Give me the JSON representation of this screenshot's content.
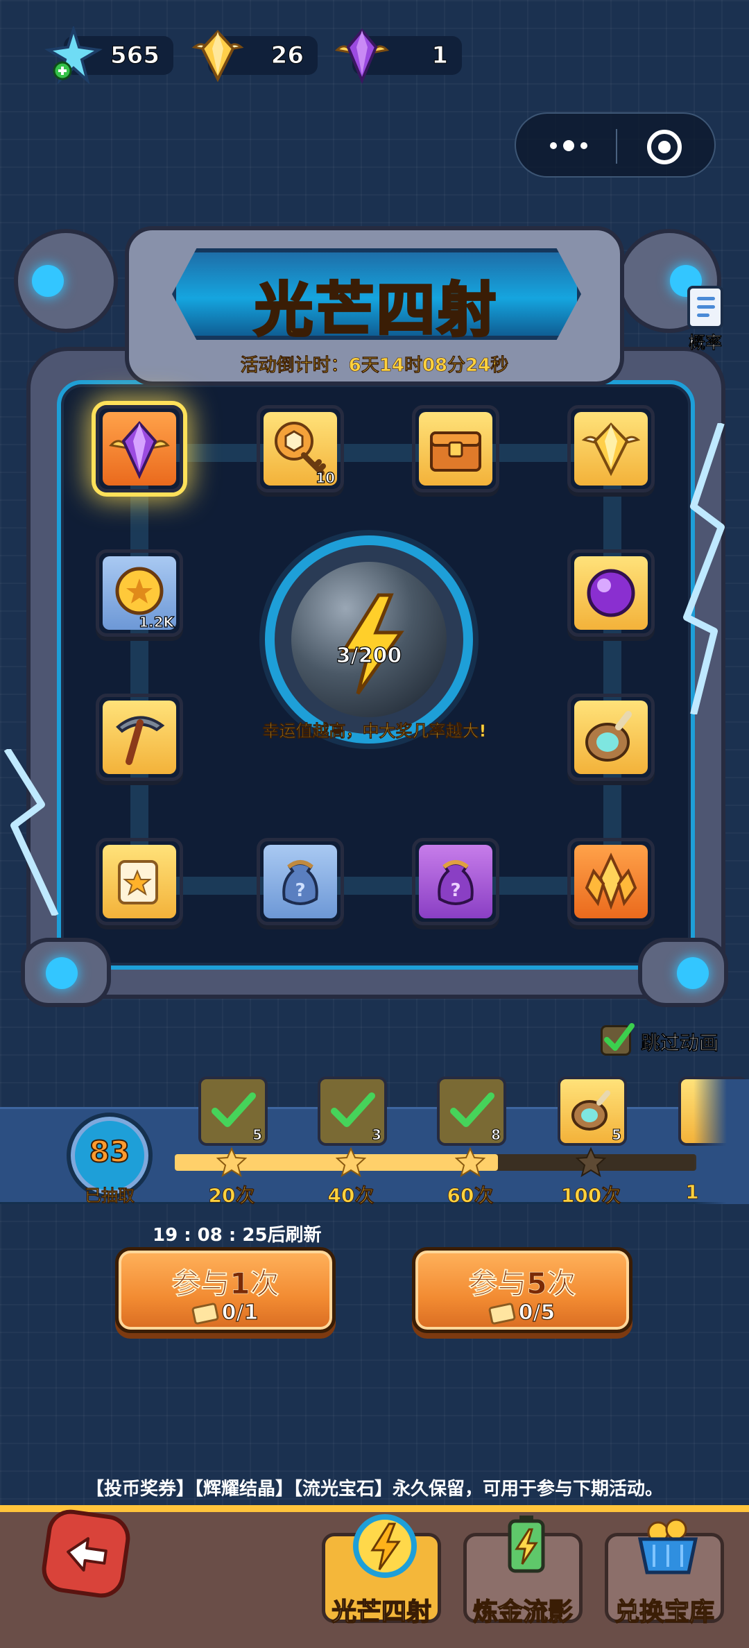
{
  "currencies": [
    {
      "name": "snowflake-energy",
      "value": "565"
    },
    {
      "name": "radiant-crystal",
      "value": "26"
    },
    {
      "name": "streamlight-gem",
      "value": "1"
    }
  ],
  "event": {
    "title": "光芒四射",
    "countdown": "活动倒计时：6天14时08分24秒",
    "rate_label": "概率"
  },
  "board_tiles": [
    {
      "id": "purple-winged-gem",
      "color": "orange",
      "qty": "",
      "selected": true
    },
    {
      "id": "badge-key",
      "color": "gold",
      "qty": "10"
    },
    {
      "id": "treasure-chest",
      "color": "gold",
      "qty": ""
    },
    {
      "id": "gold-winged-crystal",
      "color": "gold",
      "qty": ""
    },
    {
      "id": "gold-coin",
      "color": "blue",
      "qty": "1.2K"
    },
    {
      "id": "purple-orb",
      "color": "gold",
      "qty": ""
    },
    {
      "id": "pickaxe",
      "color": "gold",
      "qty": ""
    },
    {
      "id": "potion-drum",
      "color": "gold",
      "qty": ""
    },
    {
      "id": "star-scroll",
      "color": "gold",
      "qty": ""
    },
    {
      "id": "blue-mystery-bag",
      "color": "blue",
      "qty": ""
    },
    {
      "id": "purple-mystery-bag",
      "color": "purple",
      "qty": ""
    },
    {
      "id": "orange-crystal-cluster",
      "color": "orange",
      "qty": ""
    }
  ],
  "center": {
    "luck": "3/200",
    "hint": "幸运值越高，中大奖几率越大!"
  },
  "skip_animation": {
    "label": "跳过动画",
    "checked": true
  },
  "progress": {
    "draw_count": "83",
    "draw_label": "已抽取",
    "fill_fraction": 0.62,
    "milestones": [
      {
        "label": "20次",
        "qty": "5",
        "claimed": true
      },
      {
        "label": "40次",
        "qty": "3",
        "claimed": true
      },
      {
        "label": "60次",
        "qty": "8",
        "claimed": true
      },
      {
        "label": "100次",
        "qty": "5",
        "claimed": false
      },
      {
        "label": "1",
        "qty": "",
        "claimed": false
      }
    ]
  },
  "refresh_text": "19 : 08 : 25后刷新",
  "play_buttons": [
    {
      "title": "参与1次",
      "cost": "0/1"
    },
    {
      "title": "参与5次",
      "cost": "0/5"
    }
  ],
  "footer_note": "【投币奖券】【辉耀结晶】【流光宝石】永久保留，可用于参与下期活动。",
  "nav": [
    {
      "label": "光芒四射",
      "color": "#f4b73a"
    },
    {
      "label": "炼金流影",
      "color": "#8c6f6a"
    },
    {
      "label": "兑换宝库",
      "color": "#8c6f6a"
    }
  ],
  "colors": {
    "accent_gold": "#ffd23f",
    "frame_blue": "#1e9fd8",
    "button_orange": "#f28b32"
  }
}
